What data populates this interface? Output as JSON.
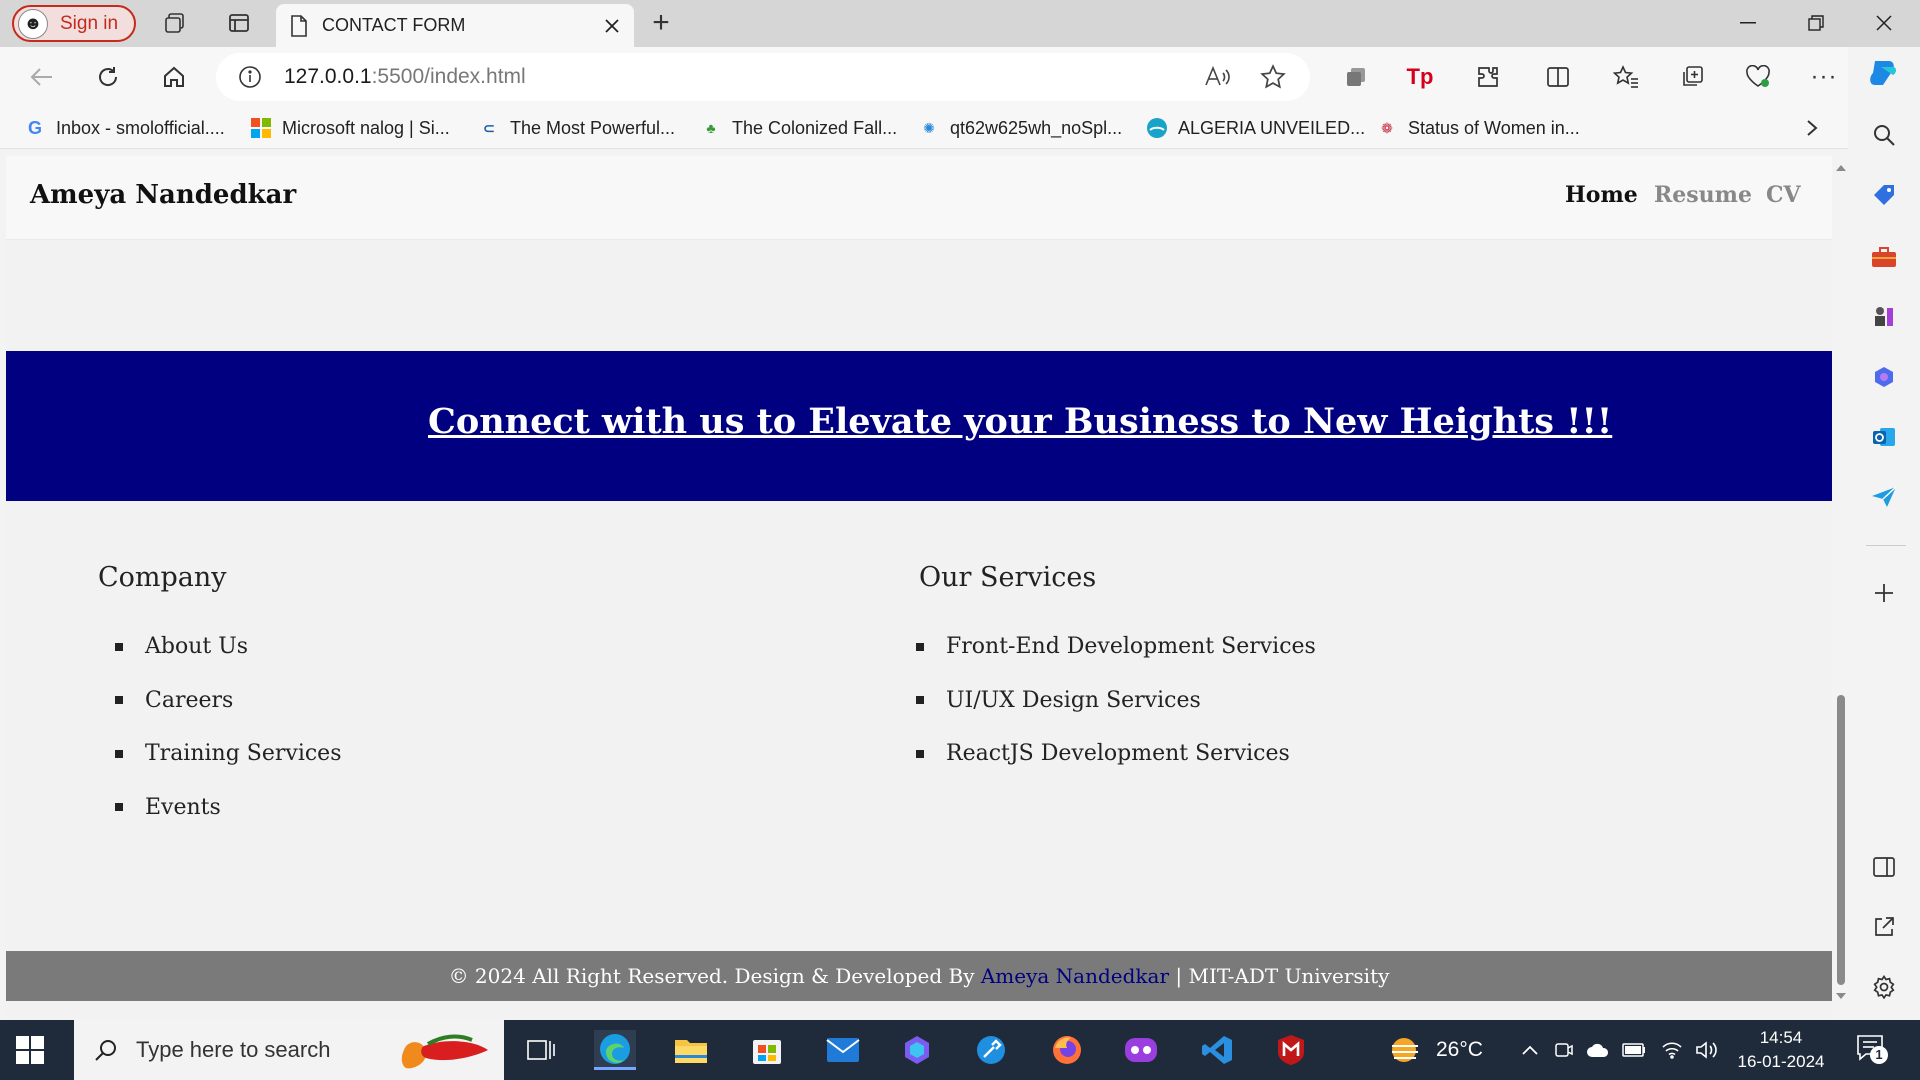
{
  "browser": {
    "signin_label": "Sign in",
    "tab_title": "CONTACT FORM",
    "url_host": "127.0.0.1",
    "url_path": ":5500/index.html",
    "favorites": [
      {
        "label": "Inbox - smolofficial...."
      },
      {
        "label": "Microsoft nalog | Si..."
      },
      {
        "label": "The Most Powerful..."
      },
      {
        "label": "The Colonized Fall..."
      },
      {
        "label": "qt62w625wh_noSpl..."
      },
      {
        "label": "ALGERIA UNVEILED..."
      },
      {
        "label": "Status of Women in..."
      }
    ]
  },
  "site": {
    "brand": "Ameya Nandedkar",
    "nav": [
      {
        "label": "Home",
        "active": true
      },
      {
        "label": "Resume",
        "active": false
      },
      {
        "label": "CV",
        "active": false
      }
    ],
    "banner": "Connect with us to Elevate your Business to New Heights !!!",
    "company": {
      "title": "Company",
      "items": [
        "About Us",
        "Careers",
        "Training Services",
        "Events"
      ]
    },
    "services": {
      "title": "Our Services",
      "items": [
        "Front-End Development Services",
        "UI/UX Design Services",
        "ReactJS Development Services"
      ]
    },
    "footer": {
      "prefix": "© 2024 All Right Reserved. Design & Developed By ",
      "author": "Ameya Nandedkar",
      "suffix": " | MIT-ADT University"
    }
  },
  "taskbar": {
    "search_placeholder": "Type here to search",
    "temperature": "26°C",
    "time": "14:54",
    "date": "16-01-2024",
    "notification_count": "1"
  },
  "colors": {
    "banner_bg": "#000080",
    "footer_bg": "#7a7a7a",
    "accent_red": "#c42b1c"
  }
}
